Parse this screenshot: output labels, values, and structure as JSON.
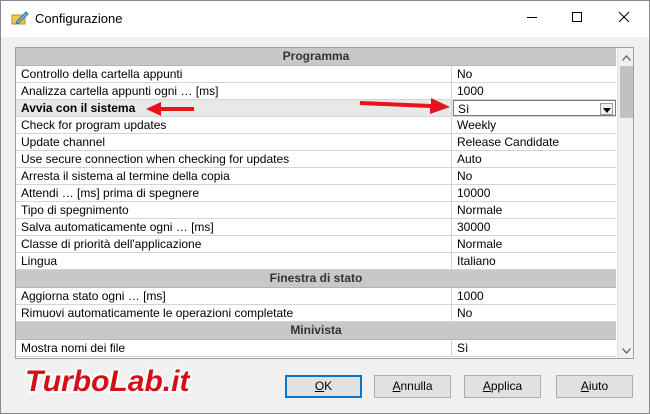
{
  "window": {
    "title": "Configurazione"
  },
  "icons": {
    "app": "pencil-folder-icon",
    "minimize": "minimize-icon",
    "maximize": "maximize-icon",
    "close": "close-icon",
    "dropdown": "chevron-down-icon",
    "scroll_up": "scroll-up-icon",
    "scroll_down": "scroll-down-icon"
  },
  "grid": {
    "sections": [
      {
        "title": "Programma",
        "rows": [
          {
            "name": "Controllo della cartella appunti",
            "value": "No"
          },
          {
            "name": "Analizza cartella appunti ogni … [ms]",
            "value": "1000"
          },
          {
            "name": "Avvia con il sistema",
            "value": "Sì"
          },
          {
            "name": "Check for program updates",
            "value": "Weekly"
          },
          {
            "name": "Update channel",
            "value": "Release Candidate"
          },
          {
            "name": "Use secure connection when checking for updates",
            "value": "Auto"
          },
          {
            "name": "Arresta il sistema al termine della copia",
            "value": "No"
          },
          {
            "name": "Attendi … [ms] prima di spegnere",
            "value": "10000"
          },
          {
            "name": "Tipo di spegnimento",
            "value": "Normale"
          },
          {
            "name": "Salva automaticamente ogni … [ms]",
            "value": "30000"
          },
          {
            "name": "Classe di priorità dell'applicazione",
            "value": "Normale"
          },
          {
            "name": "Lingua",
            "value": "Italiano"
          }
        ]
      },
      {
        "title": "Finestra di stato",
        "rows": [
          {
            "name": "Aggiorna stato ogni … [ms]",
            "value": "1000"
          },
          {
            "name": "Rimuovi automaticamente le operazioni completate",
            "value": "No"
          }
        ]
      },
      {
        "title": "Minivista",
        "rows": [
          {
            "name": "Mostra nomi dei file",
            "value": "Sì"
          }
        ]
      }
    ]
  },
  "buttons": {
    "ok": {
      "first": "O",
      "rest": "K"
    },
    "annulla": {
      "first": "A",
      "rest": "nnulla"
    },
    "applica": {
      "first": "A",
      "rest": "pplica"
    },
    "aiuto": {
      "first": "A",
      "rest": "iuto"
    }
  },
  "watermark": {
    "text": "TurboLab.it"
  },
  "colors": {
    "annotation_arrow": "#e8141c",
    "section_header": "#c8c8c8",
    "default_button_border": "#0078d7"
  }
}
